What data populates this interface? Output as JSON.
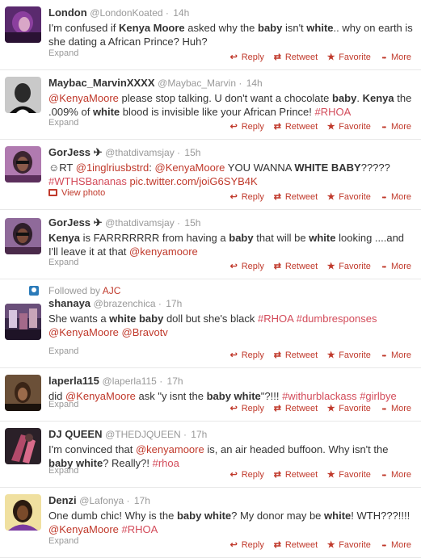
{
  "actions": {
    "reply": "Reply",
    "retweet": "Retweet",
    "favorite": "Favorite",
    "more": "More",
    "expand": "Expand",
    "view_photo": "View photo"
  },
  "colors": {
    "link": "#c0392b",
    "hashtag": "#d34b5a",
    "meta": "#999999"
  },
  "tweets": [
    {
      "name": "London",
      "handle": "@LondonKoated",
      "time": "14h",
      "parts": [
        {
          "t": "I'm confused if "
        },
        {
          "t": "Kenya Moore",
          "s": "b"
        },
        {
          "t": " asked why the "
        },
        {
          "t": "baby",
          "s": "b"
        },
        {
          "t": " isn't "
        },
        {
          "t": "white",
          "s": "b"
        },
        {
          "t": ".. why on earth is she dating a African Prince? Huh?"
        }
      ]
    },
    {
      "name": "Maybac_MarvinXXXX",
      "handle": "@Maybac_Marvin",
      "time": "14h",
      "parts": [
        {
          "t": "@KenyaMoore",
          "s": "m"
        },
        {
          "t": " please stop talking. U don't want a chocolate "
        },
        {
          "t": "baby",
          "s": "b"
        },
        {
          "t": ". "
        },
        {
          "t": "Kenya",
          "s": "b"
        },
        {
          "t": " the .009% of "
        },
        {
          "t": "white",
          "s": "b"
        },
        {
          "t": " blood is invisible like your African Prince! "
        },
        {
          "t": "#RHOA",
          "s": "h"
        }
      ]
    },
    {
      "name": "GorJess ✈",
      "handle": "@thatdivamsjay",
      "time": "15h",
      "photo": true,
      "parts": [
        {
          "t": "☺RT "
        },
        {
          "t": "@1inglriusbstrd",
          "s": "m"
        },
        {
          "t": ": "
        },
        {
          "t": "@KenyaMoore",
          "s": "m"
        },
        {
          "t": " YOU WANNA "
        },
        {
          "t": "WHITE BABY",
          "s": "b"
        },
        {
          "t": "????? "
        },
        {
          "t": "#WTHSBananas",
          "s": "h"
        },
        {
          "t": " "
        },
        {
          "t": "pic.twitter.com/joiG6SYB4K",
          "s": "m"
        }
      ]
    },
    {
      "name": "GorJess ✈",
      "handle": "@thatdivamsjay",
      "time": "15h",
      "parts": [
        {
          "t": "Kenya",
          "s": "b"
        },
        {
          "t": " is FARRRRRRR from having a "
        },
        {
          "t": "baby",
          "s": "b"
        },
        {
          "t": " that will be "
        },
        {
          "t": "white",
          "s": "b"
        },
        {
          "t": " looking ....and I'll leave it at that "
        },
        {
          "t": "@kenyamoore",
          "s": "m"
        }
      ]
    },
    {
      "followed_by": "Followed by",
      "followed_user": "AJC",
      "name": "shanaya",
      "handle": "@brazenchica",
      "time": "17h",
      "parts": [
        {
          "t": "She wants a "
        },
        {
          "t": "white baby",
          "s": "b"
        },
        {
          "t": " doll but she's black "
        },
        {
          "t": "#RHOA",
          "s": "h"
        },
        {
          "t": " "
        },
        {
          "t": "#dumbresponses",
          "s": "h"
        },
        {
          "t": " "
        },
        {
          "t": "@KenyaMoore",
          "s": "m"
        },
        {
          "t": " "
        },
        {
          "t": "@Bravotv",
          "s": "m"
        }
      ]
    },
    {
      "name": "laperla115",
      "handle": "@laperla115",
      "time": "17h",
      "parts": [
        {
          "t": "did "
        },
        {
          "t": "@KenyaMoore",
          "s": "m"
        },
        {
          "t": " ask \"y isnt the "
        },
        {
          "t": "baby white",
          "s": "b"
        },
        {
          "t": "\"?!!! "
        },
        {
          "t": "#withurblackass",
          "s": "h"
        },
        {
          "t": "  "
        },
        {
          "t": "#girlbye",
          "s": "h"
        }
      ]
    },
    {
      "name": "DJ QUEEN",
      "handle": "@THEDJQUEEN",
      "time": "17h",
      "parts": [
        {
          "t": "I'm convinced that "
        },
        {
          "t": "@kenyamoore",
          "s": "m"
        },
        {
          "t": " is, an air headed buffoon. Why isn't the "
        },
        {
          "t": "baby white",
          "s": "b"
        },
        {
          "t": "? Really?! "
        },
        {
          "t": "#rhoa",
          "s": "h"
        }
      ]
    },
    {
      "name": "Denzi",
      "handle": "@Lafonya",
      "time": "17h",
      "parts": [
        {
          "t": "One dumb chic! Why is the "
        },
        {
          "t": "baby white",
          "s": "b"
        },
        {
          "t": "? My donor may be "
        },
        {
          "t": "white",
          "s": "b"
        },
        {
          "t": "! WTH???!!!! "
        },
        {
          "t": "@KenyaMoore",
          "s": "m"
        },
        {
          "t": " "
        },
        {
          "t": "#RHOA",
          "s": "h"
        }
      ]
    }
  ]
}
